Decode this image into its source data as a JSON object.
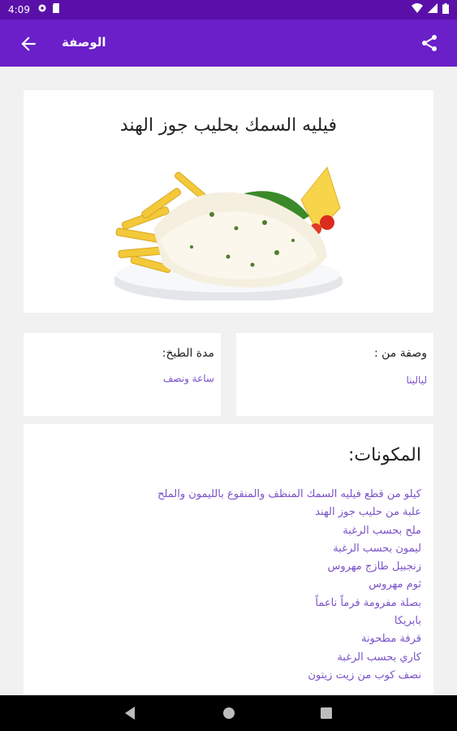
{
  "status_bar": {
    "time": "4:09"
  },
  "app_bar": {
    "title": "الوصفة"
  },
  "recipe": {
    "title": "فيليه السمك بحليب جوز الهند"
  },
  "info": {
    "from_label": "وصفة من :",
    "from_value": "ليالينا",
    "time_label": "مدة الطبخ:",
    "time_value": "ساعة ونصف"
  },
  "ingredients": {
    "title": "المكونات:",
    "items": [
      "كيلو من قطع فيليه السمك المنظف والمنقوع بالليمون والملح",
      "علبة من حليب جوز الهند",
      "ملح بحسب الرغبة",
      "ليمون بحسب الرغبة",
      "زنجبيل طازج مهروس",
      "ثوم مهروس",
      "بصلة مفرومة فرماً ناعماً",
      "بابريكا",
      "قرفة مطحونة",
      "كاري بحسب الرغبة",
      "نصف كوب من زيت زيتون"
    ]
  },
  "colors": {
    "primary": "#6a1fc8",
    "status_bar": "#5a10a8",
    "accent_text": "#7a52c9",
    "background": "#f1f1f1"
  }
}
